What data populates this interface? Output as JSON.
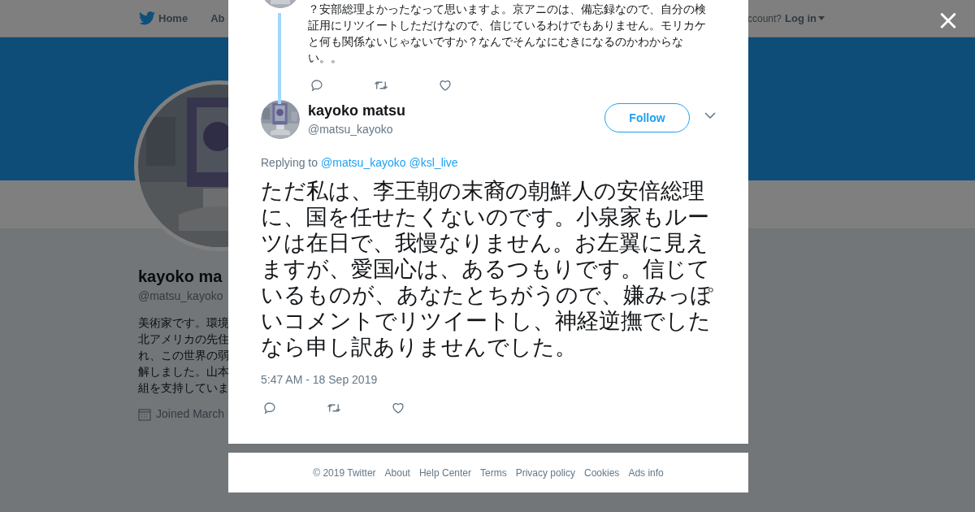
{
  "nav": {
    "items": [
      "Home",
      "Ab"
    ],
    "account_prompt": "ccount?",
    "login": "Log in"
  },
  "profile": {
    "name": "kayoko ma",
    "handle": "@matsu_kayoko",
    "bio_lines": [
      "美術家です。環境",
      "北アメリカの先住",
      "れ、この世界の弱",
      "解しました。山本",
      "組を支持していま"
    ],
    "joined": "Joined March"
  },
  "modal": {
    "parent_tweet": {
      "lines": [
        "？安部総理よかったなって思いますよ。京アニのは、備忘録なので、自分の検",
        "証用にリツイートしただけなので、信じているわけでもありません。モリカケ",
        "と何も関係ないじゃないですか？なんでそんなにむきになるのかわからな",
        "い。。"
      ]
    },
    "tweet": {
      "name": "kayoko matsu",
      "handle": "@matsu_kayoko",
      "follow_label": "Follow",
      "replying_label": "Replying to",
      "replying_to": [
        "@matsu_kayoko",
        "@ksl_live"
      ],
      "text": "ただ私は、李王朝の末裔の朝鮮人の安倍総理に、国を任せたくないのです。小泉家もルーツは在日で、我慢なりません。お左翼に見えますが、愛国心は、あるつもりです。信じているものが、あなたとちがうので、嫌みっぽいコメントでリツイートし、神経逆撫でしたなら申し訳ありませんでした。",
      "timestamp": "5:47 AM - 18 Sep 2019"
    },
    "footer_links": [
      "© 2019 Twitter",
      "About",
      "Help Center",
      "Terms",
      "Privacy policy",
      "Cookies",
      "Ads info"
    ]
  },
  "close": "×"
}
